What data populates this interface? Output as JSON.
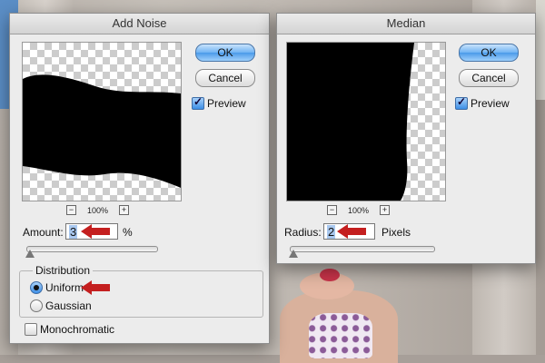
{
  "add_noise": {
    "title": "Add Noise",
    "ok_label": "OK",
    "cancel_label": "Cancel",
    "preview_label": "Preview",
    "preview_checked": true,
    "zoom_level": "100%",
    "amount_label": "Amount:",
    "amount_value": "3",
    "amount_unit": "%",
    "distribution_label": "Distribution",
    "distribution_options": [
      "Uniform",
      "Gaussian"
    ],
    "distribution_selected": "Uniform",
    "monochromatic_label": "Monochromatic",
    "monochromatic_checked": false
  },
  "median": {
    "title": "Median",
    "ok_label": "OK",
    "cancel_label": "Cancel",
    "preview_label": "Preview",
    "preview_checked": true,
    "zoom_level": "100%",
    "radius_label": "Radius:",
    "radius_value": "2",
    "radius_unit": "Pixels"
  },
  "colors": {
    "annotation_arrow": "#c41f1f",
    "default_button": "#4a9ae9",
    "dialog_bg": "#ececec"
  }
}
